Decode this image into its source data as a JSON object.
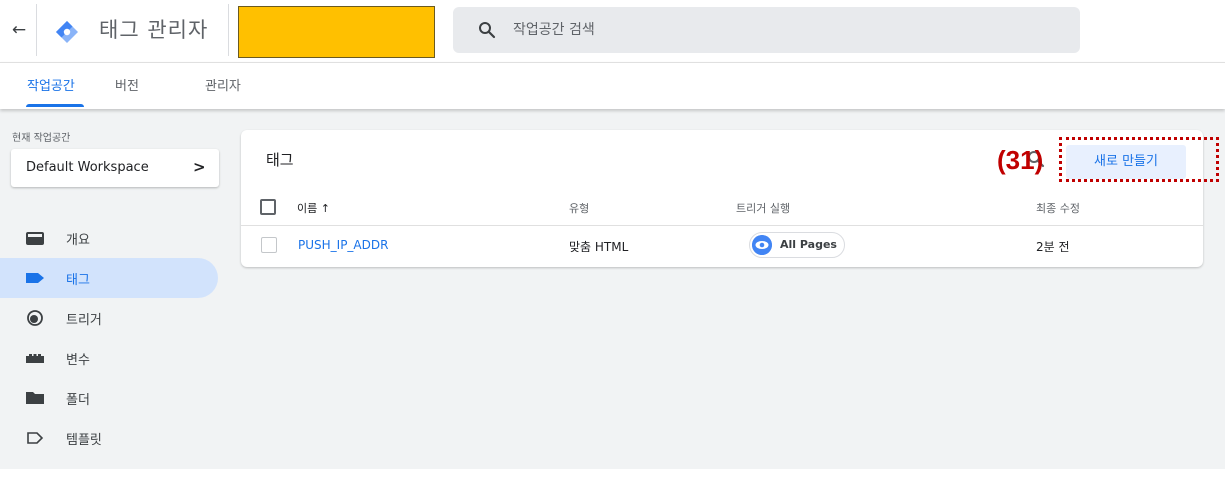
{
  "header": {
    "back_icon": "arrow-back-icon",
    "app_title": "태그 관리자",
    "search_placeholder": "작업공간 검색"
  },
  "tabs": [
    {
      "label": "작업공간",
      "active": true
    },
    {
      "label": "버전",
      "active": false
    },
    {
      "label": "관리자",
      "active": false
    }
  ],
  "sidebar": {
    "workspace_label": "현재 작업공간",
    "workspace_name": "Default Workspace",
    "items": [
      {
        "label": "개요",
        "icon": "overview-icon",
        "active": false
      },
      {
        "label": "태그",
        "icon": "tag-icon",
        "active": true
      },
      {
        "label": "트리거",
        "icon": "trigger-icon",
        "active": false
      },
      {
        "label": "변수",
        "icon": "variables-icon",
        "active": false
      },
      {
        "label": "폴더",
        "icon": "folder-icon",
        "active": false
      },
      {
        "label": "템플릿",
        "icon": "template-icon",
        "active": false
      }
    ]
  },
  "card": {
    "title": "태그",
    "annotation": "(31)",
    "new_button": "새로 만들기",
    "columns": {
      "name": "이름 ↑",
      "type": "유형",
      "trigger": "트리거 실행",
      "modified": "최종 수정"
    },
    "rows": [
      {
        "name": "PUSH_IP_ADDR",
        "type": "맞춤 HTML",
        "trigger": "All Pages",
        "modified": "2분 전"
      }
    ]
  },
  "colors": {
    "accent": "#1a73e8",
    "active_nav_bg": "#d2e3fc",
    "account_highlight": "#ffc000",
    "annotation": "#c00000"
  }
}
